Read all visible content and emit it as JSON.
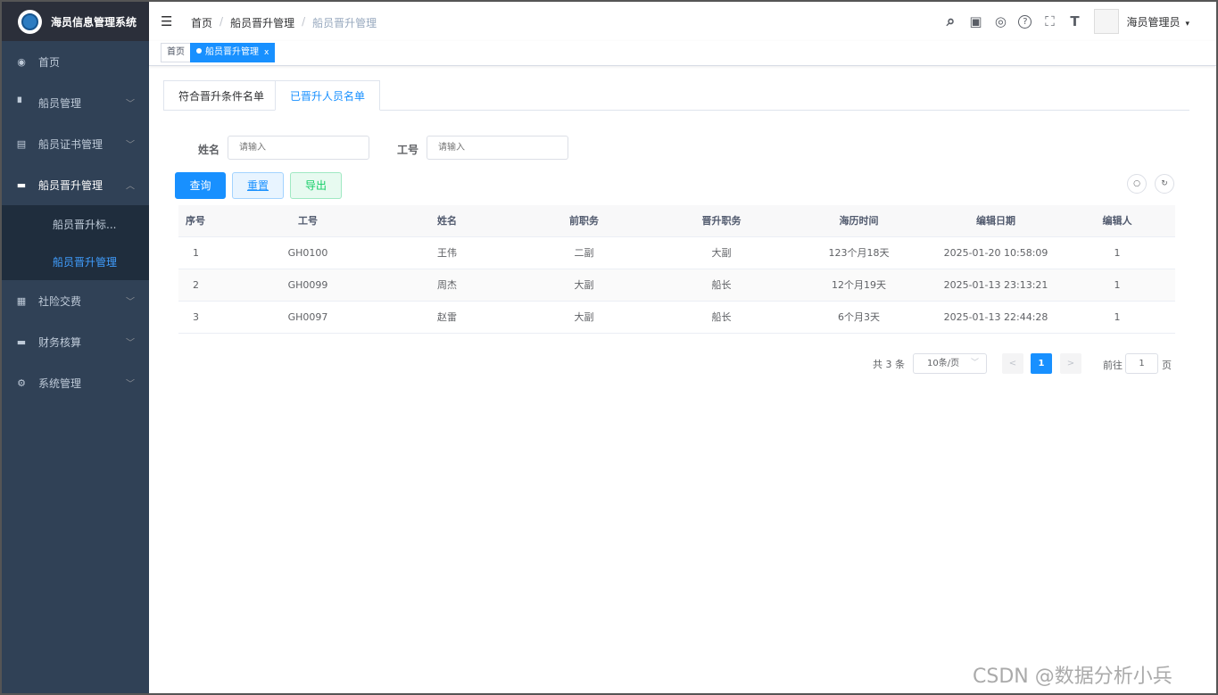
{
  "app": {
    "title": "海员信息管理系统"
  },
  "sidebar": {
    "items": [
      {
        "label": "首页",
        "icon": "dashboard-icon",
        "glyph": "◉"
      },
      {
        "label": "船员管理",
        "icon": "copy-icon",
        "glyph": "▘"
      },
      {
        "label": "船员证书管理",
        "icon": "certificate-icon",
        "glyph": "▤"
      },
      {
        "label": "船员晋升管理",
        "icon": "document-icon",
        "glyph": "▬"
      },
      {
        "label": "社险交费",
        "icon": "calendar-icon",
        "glyph": "▦"
      },
      {
        "label": "财务核算",
        "icon": "document-icon",
        "glyph": "▬"
      },
      {
        "label": "系统管理",
        "icon": "gear-icon",
        "glyph": "⚙"
      }
    ],
    "submenu": [
      {
        "label": "船员晋升标..."
      },
      {
        "label": "船员晋升管理"
      }
    ],
    "arrows": {
      "down": "﹀",
      "up": "︿"
    }
  },
  "header": {
    "hamburger": "☰",
    "breadcrumb": [
      "首页",
      "船员晋升管理",
      "船员晋升管理"
    ],
    "sep": "/",
    "icons": {
      "search": "⌕",
      "message": "▣",
      "github": "◎",
      "help": "?",
      "fullscreen": "⛶",
      "font": "T"
    },
    "username": "海员管理员",
    "caret": "▾"
  },
  "tags": {
    "home": "首页",
    "active": "船员晋升管理",
    "close": "x"
  },
  "tabs": [
    "符合晋升条件名单",
    "已晋升人员名单"
  ],
  "search": {
    "name_label": "姓名",
    "name_placeholder": "请输入",
    "id_label": "工号",
    "id_placeholder": "请输入"
  },
  "buttons": {
    "query": "查询",
    "reset": "重置",
    "export": "导出",
    "search_toggle": "○",
    "refresh": "↻"
  },
  "table": {
    "columns": [
      "序号",
      "工号",
      "姓名",
      "前职务",
      "晋升职务",
      "海历时间",
      "编辑日期",
      "编辑人"
    ],
    "rows": [
      [
        "1",
        "GH0100",
        "王伟",
        "二副",
        "大副",
        "123个月18天",
        "2025-01-20 10:58:09",
        "1"
      ],
      [
        "2",
        "GH0099",
        "周杰",
        "大副",
        "船长",
        "12个月19天",
        "2025-01-13 23:13:21",
        "1"
      ],
      [
        "3",
        "GH0097",
        "赵雷",
        "大副",
        "船长",
        "6个月3天",
        "2025-01-13 22:44:28",
        "1"
      ]
    ]
  },
  "pagination": {
    "total": "共 3 条",
    "page_size": "10条/页",
    "size_chevron": "﹀",
    "prev": "<",
    "next": ">",
    "current": "1",
    "goto": "前往",
    "goto_value": "1",
    "page_suffix": "页"
  },
  "watermark": "CSDN @数据分析小兵",
  "colors": {
    "sidebar_bg": "#304156",
    "submenu_bg": "#1f2d3d",
    "primary": "#1890ff",
    "success": "#13ce66"
  }
}
